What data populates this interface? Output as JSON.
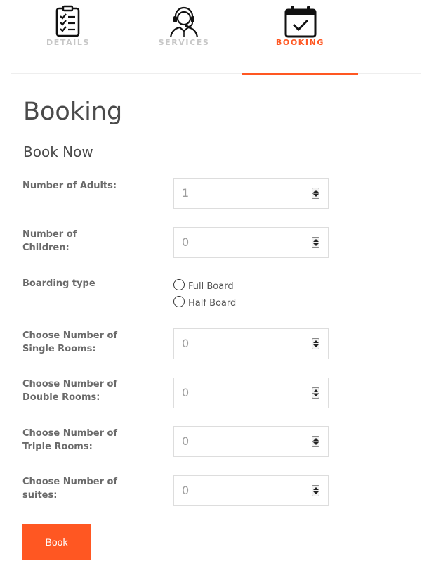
{
  "tabs": [
    {
      "label": "DETAILS",
      "icon": "checklist-icon",
      "active": false
    },
    {
      "label": "SERVICES",
      "icon": "support-agent-icon",
      "active": false
    },
    {
      "label": "BOOKING",
      "icon": "calendar-check-icon",
      "active": true
    }
  ],
  "accent_color": "#ff5722",
  "page": {
    "title": "Booking",
    "subtitle": "Book Now"
  },
  "form": {
    "adults": {
      "label": "Number of Adults:",
      "value": "1"
    },
    "children": {
      "label": "Number of Children:",
      "value": "0"
    },
    "boarding": {
      "label": "Boarding type",
      "options": [
        {
          "label": "Full Board",
          "selected": false
        },
        {
          "label": "Half Board",
          "selected": false
        }
      ]
    },
    "single_rooms": {
      "label": "Choose Number of Single Rooms:",
      "value": "0"
    },
    "double_rooms": {
      "label": "Choose Number of Double Rooms:",
      "value": "0"
    },
    "triple_rooms": {
      "label": "Choose Number of Triple Rooms:",
      "value": "0"
    },
    "suites": {
      "label": "Choose Number of suites:",
      "value": "0"
    }
  },
  "submit_label": "Book"
}
